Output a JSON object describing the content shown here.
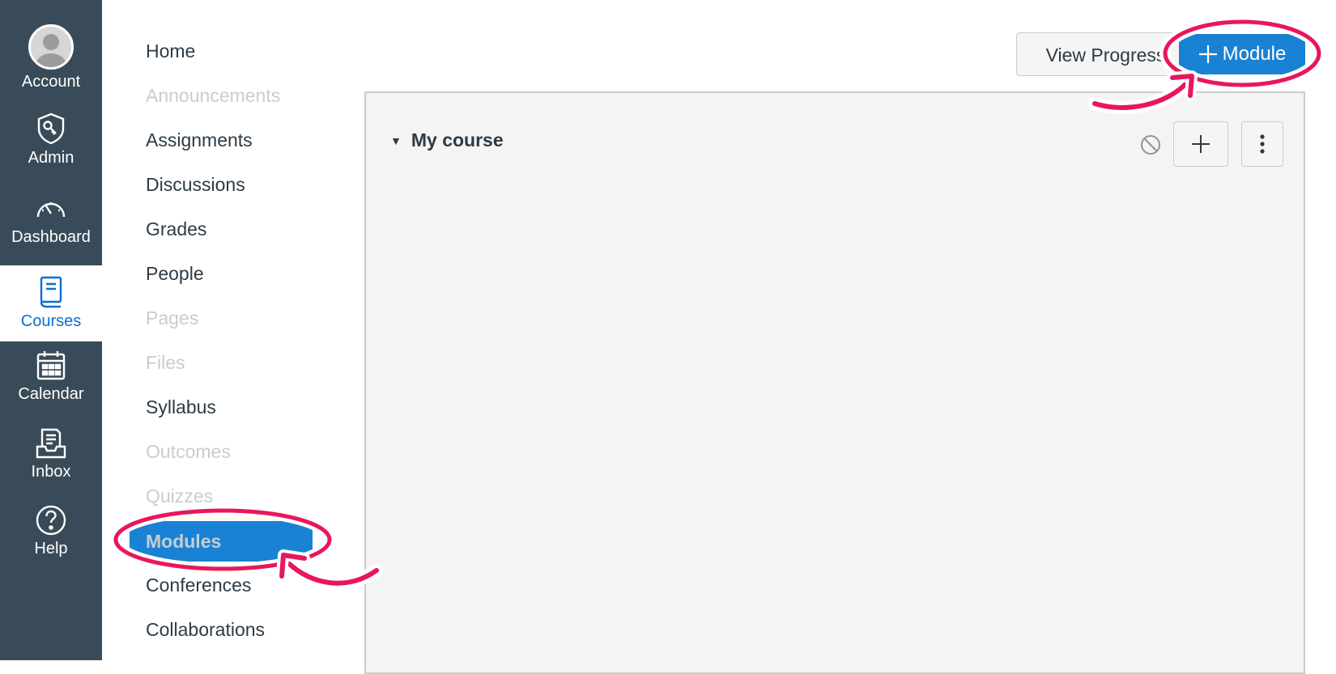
{
  "global_nav": [
    {
      "key": "account",
      "label": "Account",
      "icon": "account-avatar"
    },
    {
      "key": "admin",
      "label": "Admin",
      "icon": "shield-key-icon"
    },
    {
      "key": "dashboard",
      "label": "Dashboard",
      "icon": "speedometer-icon"
    },
    {
      "key": "courses",
      "label": "Courses",
      "icon": "book-icon",
      "active": true
    },
    {
      "key": "calendar",
      "label": "Calendar",
      "icon": "calendar-icon"
    },
    {
      "key": "inbox",
      "label": "Inbox",
      "icon": "inbox-icon"
    },
    {
      "key": "help",
      "label": "Help",
      "icon": "question-icon"
    }
  ],
  "course_nav": [
    {
      "label": "Home",
      "state": "normal"
    },
    {
      "label": "Announcements",
      "state": "disabled"
    },
    {
      "label": "Assignments",
      "state": "normal"
    },
    {
      "label": "Discussions",
      "state": "normal"
    },
    {
      "label": "Grades",
      "state": "normal"
    },
    {
      "label": "People",
      "state": "normal"
    },
    {
      "label": "Pages",
      "state": "disabled"
    },
    {
      "label": "Files",
      "state": "disabled"
    },
    {
      "label": "Syllabus",
      "state": "normal"
    },
    {
      "label": "Outcomes",
      "state": "disabled"
    },
    {
      "label": "Quizzes",
      "state": "disabled"
    },
    {
      "label": "Modules",
      "state": "active"
    },
    {
      "label": "Conferences",
      "state": "normal"
    },
    {
      "label": "Collaborations",
      "state": "normal"
    }
  ],
  "header": {
    "view_progress_label": "View Progress",
    "add_module_label": "Module"
  },
  "module": {
    "title": "My course"
  },
  "colors": {
    "nav_bg": "#394b58",
    "accent": "#1a82d4",
    "annotation": "#e8175d"
  }
}
